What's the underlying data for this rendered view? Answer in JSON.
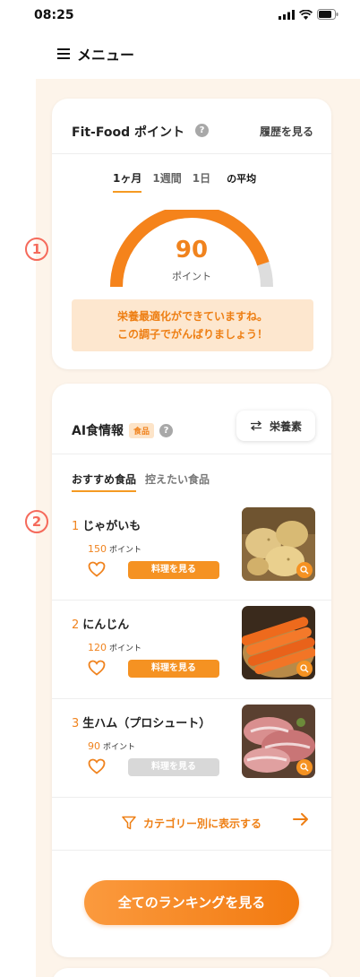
{
  "status_bar": {
    "time": "08:25"
  },
  "menu": {
    "label": "メニュー"
  },
  "points_card": {
    "marker": "1",
    "title": "Fit-Food ポイント",
    "help": "?",
    "history_link": "履歴を見る",
    "period_tabs": [
      "1ヶ月",
      "1週間",
      "1日"
    ],
    "active_period": "1ヶ月",
    "period_suffix": "の平均",
    "score": "90",
    "score_level": 0.9,
    "score_unit": "ポイント",
    "message_line1": "栄養最適化ができていますね。",
    "message_line2": "この調子でがんばりましょう！"
  },
  "ai_card": {
    "marker": "2",
    "title": "AI食情報",
    "badge": "食品",
    "help": "?",
    "nutrient_button": "栄養素",
    "tabs": [
      "おすすめ食品",
      "控えたい食品"
    ],
    "items": [
      {
        "rank": "1",
        "name": "じゃがいも",
        "points": "150",
        "unit": "ポイント",
        "button": "料理を見る",
        "enabled": true,
        "image": "potato-photo"
      },
      {
        "rank": "2",
        "name": "にんじん",
        "points": "120",
        "unit": "ポイント",
        "button": "料理を見る",
        "enabled": true,
        "image": "carrot-photo"
      },
      {
        "rank": "3",
        "name": "生ハム（プロシュート）",
        "points": "90",
        "unit": "ポイント",
        "button": "料理を見る",
        "enabled": false,
        "image": "prosciutto-photo"
      }
    ],
    "category_link": "カテゴリー別に表示する",
    "ranking_button": "全てのランキングを見る"
  },
  "colors": {
    "accent": "#f0831e",
    "background": "#fdf4ea",
    "marker": "#f56a5b"
  }
}
